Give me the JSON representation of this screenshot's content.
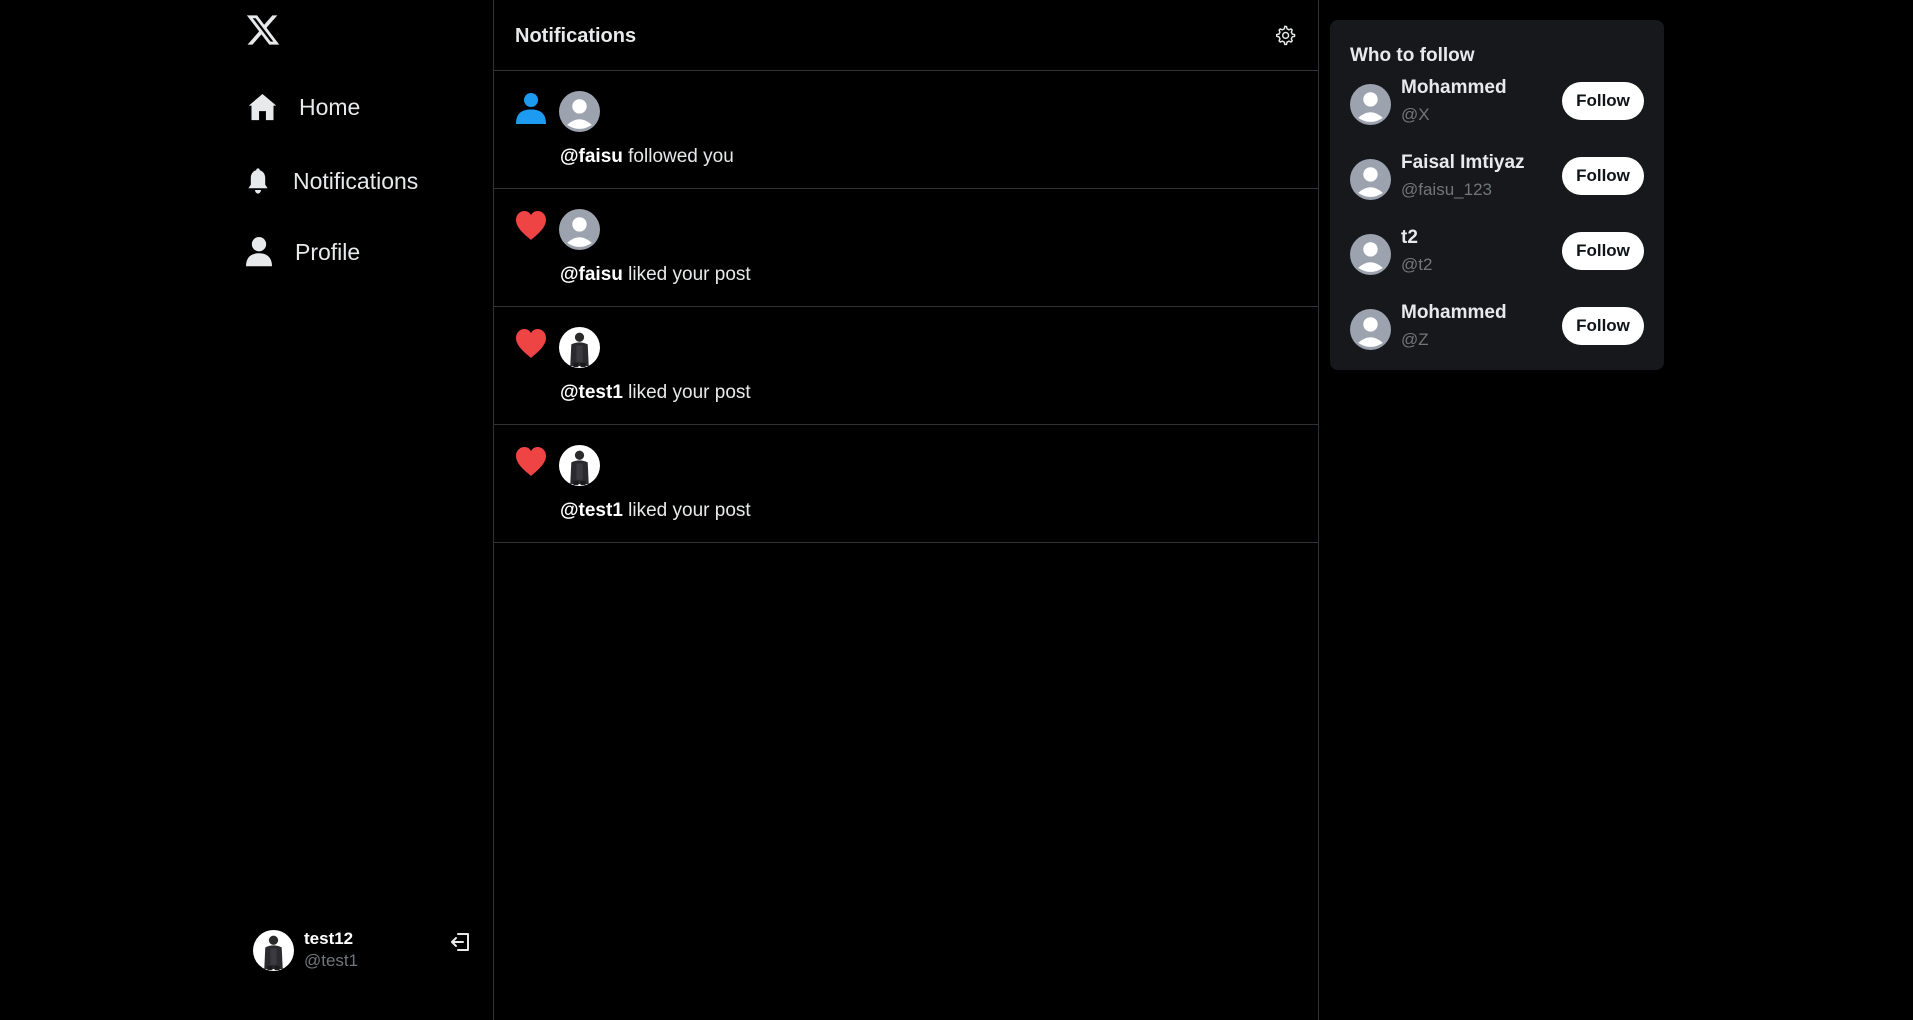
{
  "sidebar": {
    "logo": "x-logo-icon",
    "items": [
      {
        "label": "Home",
        "icon": "home-icon"
      },
      {
        "label": "Notifications",
        "icon": "bell-icon"
      },
      {
        "label": "Profile",
        "icon": "user-icon"
      }
    ],
    "account": {
      "name": "test12",
      "handle": "@test1"
    }
  },
  "main": {
    "title": "Notifications",
    "notifications": [
      {
        "type": "follow",
        "icon": "person-icon",
        "user": "@faisu",
        "action": "followed you"
      },
      {
        "type": "like",
        "icon": "heart-icon",
        "user": "@faisu",
        "action": "liked your post"
      },
      {
        "type": "like",
        "icon": "heart-icon",
        "user": "@test1",
        "action": "liked your post"
      },
      {
        "type": "like",
        "icon": "heart-icon",
        "user": "@test1",
        "action": "liked your post"
      }
    ]
  },
  "who_to_follow": {
    "title": "Who to follow",
    "follow_label": "Follow",
    "users": [
      {
        "name": "Mohammed",
        "handle": "@X"
      },
      {
        "name": "Faisal Imtiyaz",
        "handle": "@faisu_123"
      },
      {
        "name": "t2",
        "handle": "@t2"
      },
      {
        "name": "Mohammed",
        "handle": "@Z"
      }
    ]
  },
  "colors": {
    "background": "#000000",
    "border": "#2f3336",
    "panel": "#16181c",
    "text": "#e7e9ea",
    "muted": "#71767b",
    "like": "#f91880",
    "follow_icon": "#1d9bf0"
  }
}
